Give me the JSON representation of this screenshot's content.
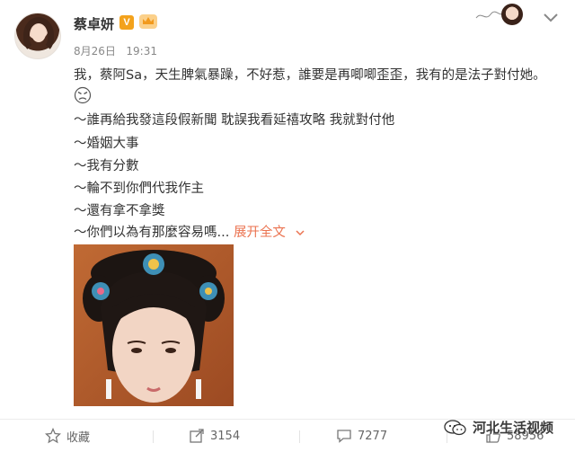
{
  "user": {
    "name": "蔡卓妍",
    "verified_badge": "V",
    "date": "8月26日",
    "time": "19:31"
  },
  "post": {
    "line1": "我，蔡阿Sa，天生脾氣暴躁，不好惹，誰要是再唧唧歪歪，我有的是法子對付她。",
    "line2": "～誰再給我發這段假新聞 耽誤我看延禧攻略 我就對付他",
    "line3": "～婚姻大事",
    "line4": "～我有分數",
    "line5": "～輪不到你們代我作主",
    "line6": "～還有拿不拿獎",
    "line7": "～你們以為有那麼容易嗎...",
    "expand_label": "展开全文",
    "emoji_icon": "angry-face-icon"
  },
  "footer": {
    "favorite_label": "收藏",
    "share_count": "3154",
    "comment_count": "7277",
    "like_count": "58956"
  },
  "watermark": {
    "text": "河北生活视频"
  },
  "colors": {
    "accent_link": "#eb7350",
    "verified": "#f3a21c",
    "text": "#333333",
    "meta": "#888888"
  }
}
